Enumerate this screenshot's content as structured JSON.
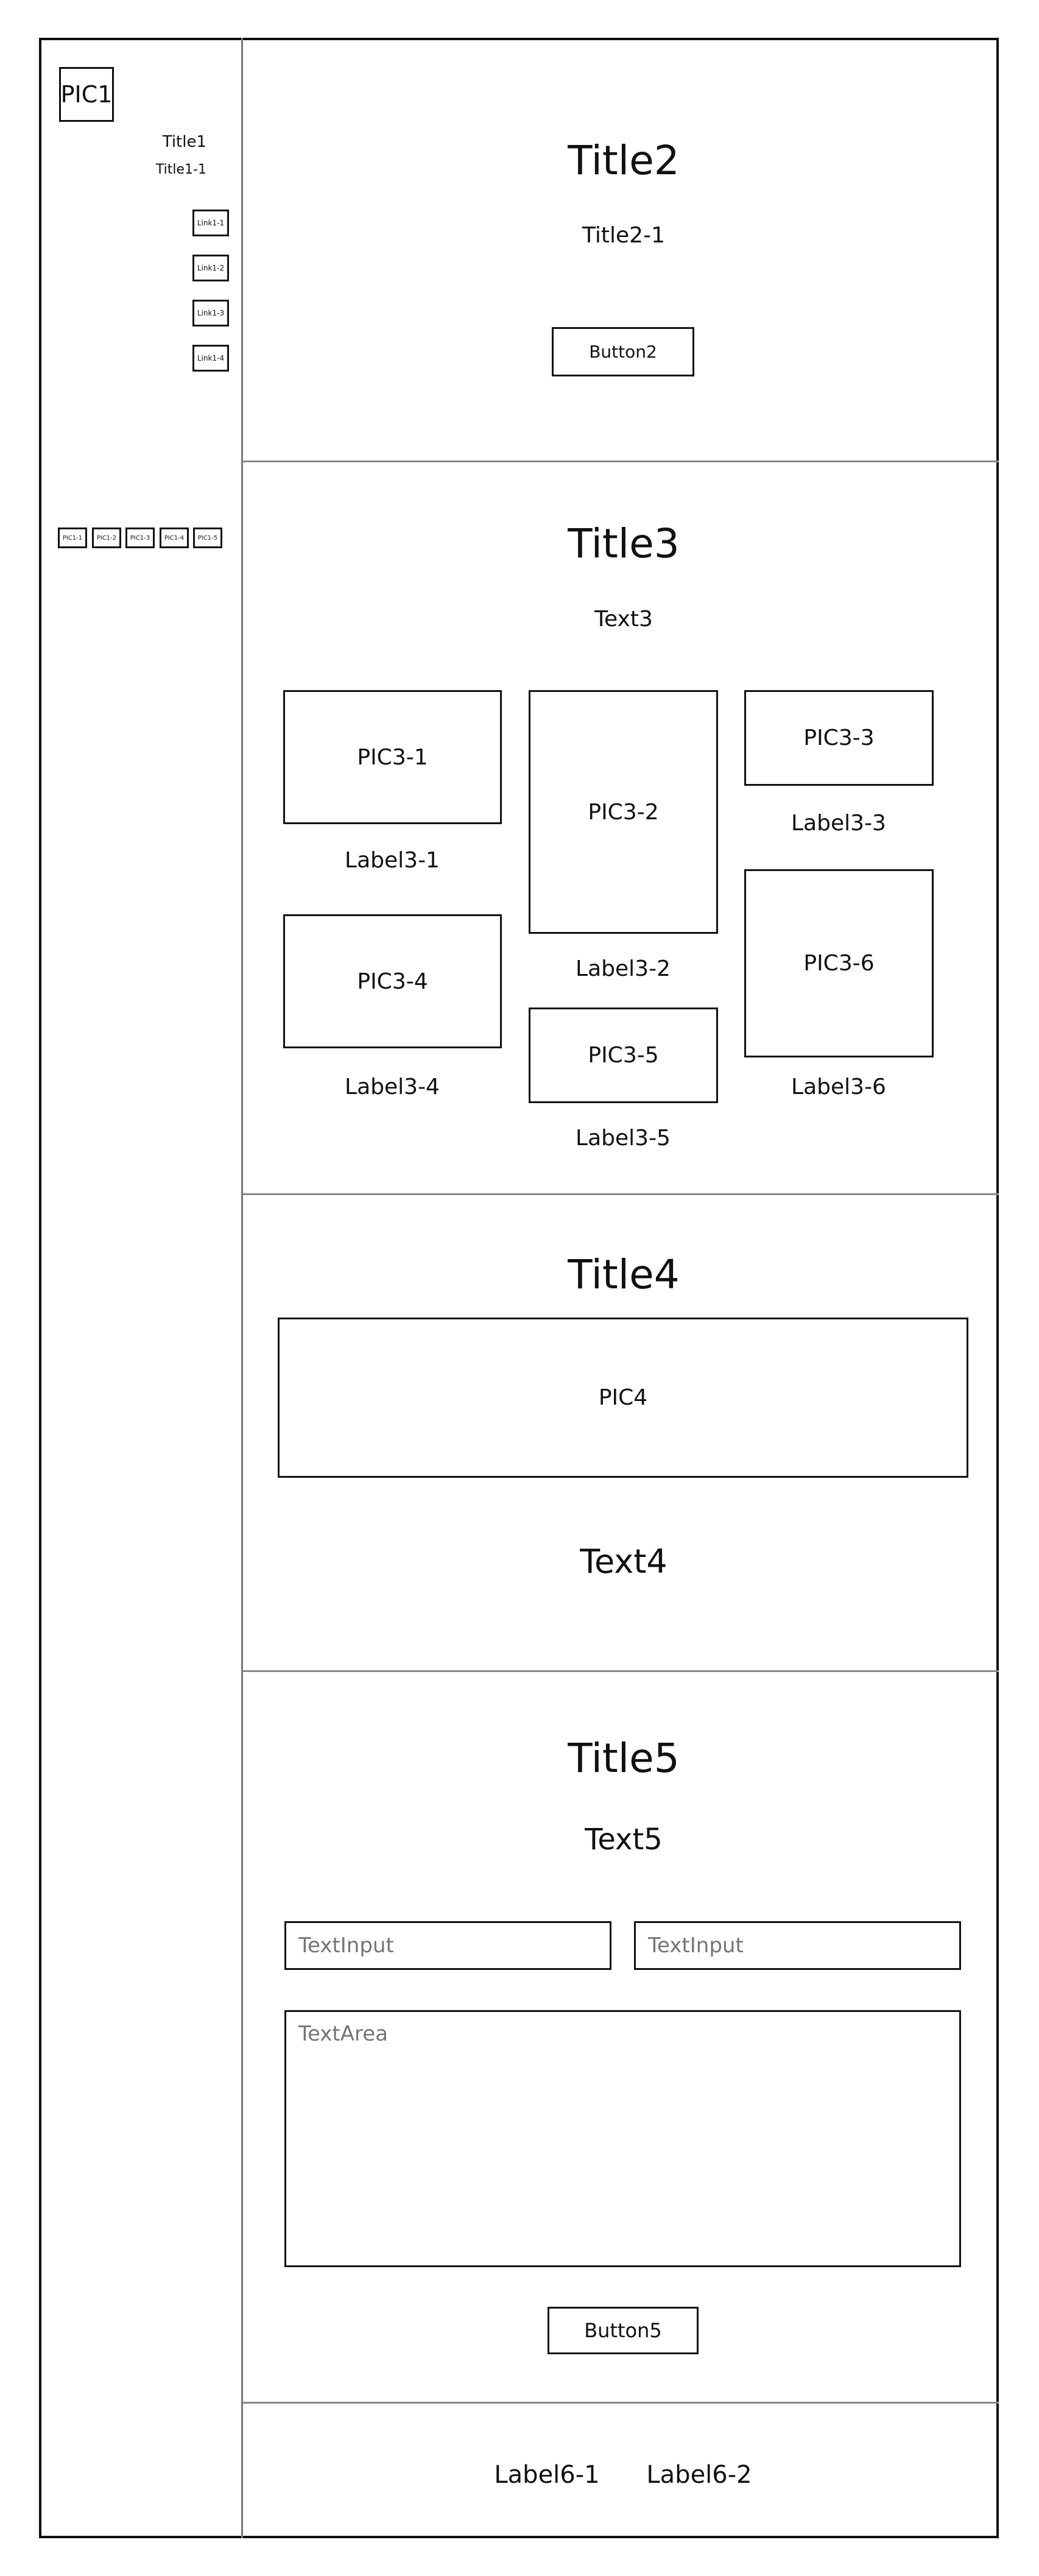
{
  "sidebar": {
    "logo": "PIC1",
    "title": "Title1",
    "subtitle": "Title1-1",
    "links": [
      "Link1-1",
      "Link1-2",
      "Link1-3",
      "Link1-4"
    ],
    "pics": [
      "PIC1-1",
      "PIC1-2",
      "PIC1-3",
      "PIC1-4",
      "PIC1-5"
    ]
  },
  "section2": {
    "title": "Title2",
    "subtitle": "Title2-1",
    "button": "Button2"
  },
  "section3": {
    "title": "Title3",
    "text": "Text3",
    "items": [
      {
        "pic": "PIC3-1",
        "label": "Label3-1"
      },
      {
        "pic": "PIC3-2",
        "label": "Label3-2"
      },
      {
        "pic": "PIC3-3",
        "label": "Label3-3"
      },
      {
        "pic": "PIC3-4",
        "label": "Label3-4"
      },
      {
        "pic": "PIC3-5",
        "label": "Label3-5"
      },
      {
        "pic": "PIC3-6",
        "label": "Label3-6"
      }
    ]
  },
  "section4": {
    "title": "Title4",
    "pic": "PIC4",
    "text": "Text4"
  },
  "section5": {
    "title": "Title5",
    "text": "Text5",
    "input1_placeholder": "TextInput",
    "input2_placeholder": "TextInput",
    "textarea_placeholder": "TextArea",
    "button": "Button5"
  },
  "footer": {
    "label1": "Label6-1",
    "label2": "Label6-2"
  }
}
